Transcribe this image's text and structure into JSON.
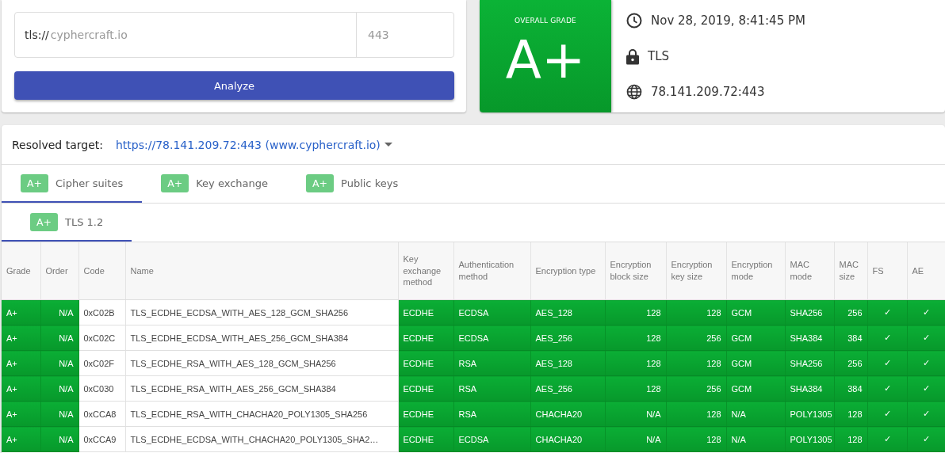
{
  "scan": {
    "scheme": "tls://",
    "host_placeholder": "cyphercraft.io",
    "port_placeholder": "443",
    "button": "Analyze"
  },
  "summary": {
    "grade_label": "OVERALL GRADE",
    "grade": "A+",
    "date": "Nov 28, 2019, 8:41:45 PM",
    "protocol": "TLS",
    "address": "78.141.209.72:443"
  },
  "target": {
    "label": "Resolved target:",
    "value": "https://78.141.209.72:443 (www.cyphercraft.io)"
  },
  "tabs": [
    {
      "grade": "A+",
      "label": "Cipher suites",
      "selected": true
    },
    {
      "grade": "A+",
      "label": "Key exchange",
      "selected": false
    },
    {
      "grade": "A+",
      "label": "Public keys",
      "selected": false
    }
  ],
  "subtabs": [
    {
      "grade": "A+",
      "label": "TLS 1.2",
      "selected": true
    }
  ],
  "table": {
    "columns": [
      {
        "label": "Grade",
        "highlighted": true,
        "kind": "text"
      },
      {
        "label": "Order",
        "highlighted": true,
        "kind": "number"
      },
      {
        "label": "Code",
        "highlighted": false,
        "kind": "text"
      },
      {
        "label": "Name",
        "highlighted": false,
        "kind": "text"
      },
      {
        "label": "Key exchange method",
        "highlighted": true,
        "kind": "text"
      },
      {
        "label": "Authentication method",
        "highlighted": true,
        "kind": "text"
      },
      {
        "label": "Encryption type",
        "highlighted": true,
        "kind": "text"
      },
      {
        "label": "Encryption block size",
        "highlighted": true,
        "kind": "number"
      },
      {
        "label": "Encryption key size",
        "highlighted": true,
        "kind": "number"
      },
      {
        "label": "Encryption mode",
        "highlighted": true,
        "kind": "text"
      },
      {
        "label": "MAC mode",
        "highlighted": true,
        "kind": "text"
      },
      {
        "label": "MAC size",
        "highlighted": true,
        "kind": "number"
      },
      {
        "label": "FS",
        "highlighted": true,
        "kind": "flag"
      },
      {
        "label": "AE",
        "highlighted": true,
        "kind": "flag"
      }
    ],
    "rows": [
      [
        "A+",
        "N/A",
        "0xC02B",
        "TLS_ECDHE_ECDSA_WITH_AES_128_GCM_SHA256",
        "ECDHE",
        "ECDSA",
        "AES_128",
        "128",
        "128",
        "GCM",
        "SHA256",
        "256",
        "✓",
        "✓"
      ],
      [
        "A+",
        "N/A",
        "0xC02C",
        "TLS_ECDHE_ECDSA_WITH_AES_256_GCM_SHA384",
        "ECDHE",
        "ECDSA",
        "AES_256",
        "128",
        "256",
        "GCM",
        "SHA384",
        "384",
        "✓",
        "✓"
      ],
      [
        "A+",
        "N/A",
        "0xC02F",
        "TLS_ECDHE_RSA_WITH_AES_128_GCM_SHA256",
        "ECDHE",
        "RSA",
        "AES_128",
        "128",
        "128",
        "GCM",
        "SHA256",
        "256",
        "✓",
        "✓"
      ],
      [
        "A+",
        "N/A",
        "0xC030",
        "TLS_ECDHE_RSA_WITH_AES_256_GCM_SHA384",
        "ECDHE",
        "RSA",
        "AES_256",
        "128",
        "256",
        "GCM",
        "SHA384",
        "384",
        "✓",
        "✓"
      ],
      [
        "A+",
        "N/A",
        "0xCCA8",
        "TLS_ECDHE_RSA_WITH_CHACHA20_POLY1305_SHA256",
        "ECDHE",
        "RSA",
        "CHACHA20",
        "N/A",
        "128",
        "N/A",
        "POLY1305",
        "128",
        "✓",
        "✓"
      ],
      [
        "A+",
        "N/A",
        "0xCCA9",
        "TLS_ECDHE_ECDSA_WITH_CHACHA20_POLY1305_SHA2…",
        "ECDHE",
        "ECDSA",
        "CHACHA20",
        "N/A",
        "128",
        "N/A",
        "POLY1305",
        "128",
        "✓",
        "✓"
      ]
    ]
  }
}
